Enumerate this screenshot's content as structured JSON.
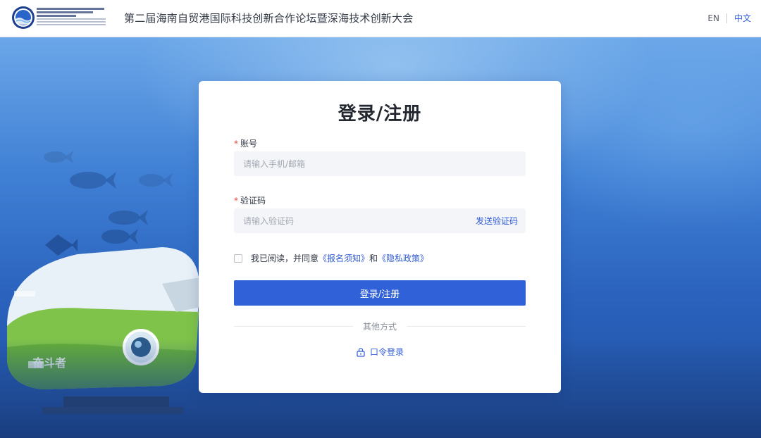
{
  "header": {
    "site_title": "第二届海南自贸港国际科技创新合作论坛暨深海技术创新大会",
    "lang_en": "EN",
    "lang_zh": "中文"
  },
  "login": {
    "title": "登录/注册",
    "account_label": "账号",
    "account_placeholder": "请输入手机/邮箱",
    "code_label": "验证码",
    "code_placeholder": "请输入验证码",
    "send_code": "发送验证码",
    "agree_prefix": "我已阅读，并同意",
    "notice_link": "《报名须知》",
    "and_text": "和",
    "privacy_link": "《隐私政策》",
    "submit": "登录/注册",
    "other_methods": "其他方式",
    "password_login": "口令登录",
    "required_mark": "*"
  },
  "colors": {
    "accent": "#3161d9",
    "link": "#2f5bd6",
    "required": "#e0473c"
  },
  "icons": {
    "logo": "forum-logo",
    "lock": "lock-icon"
  }
}
